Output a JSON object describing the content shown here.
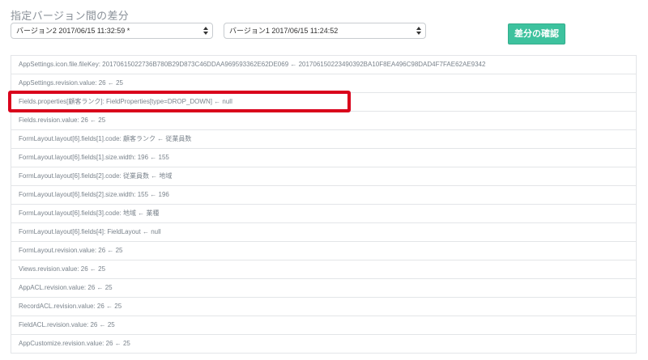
{
  "page": {
    "title": "指定バージョン間の差分"
  },
  "controls": {
    "version_a": "バージョン2 2017/06/15 11:32:59 *",
    "version_b": "バージョン1 2017/06/15 11:24:52",
    "compare_button": "差分の確認"
  },
  "diff_rows": [
    "AppSettings.icon.file.fileKey: 20170615022736B780B29D873C46DDAA969593362E62DE069 ← 20170615022349039​2BA10F8EA496C98DAD4F7FAE62AE9342",
    "AppSettings.revision.value: 26 ← 25",
    "Fields.properties[顧客ランク]: FieldProperties[type=DROP_DOWN] ← null",
    "Fields.revision.value: 26 ← 25",
    "FormLayout.layout[6].fields[1].code: 顧客ランク ← 従業員数",
    "FormLayout.layout[6].fields[1].size.width: 196 ← 155",
    "FormLayout.layout[6].fields[2].code: 従業員数 ← 地域",
    "FormLayout.layout[6].fields[2].size.width: 155 ← 196",
    "FormLayout.layout[6].fields[3].code: 地域 ← 業種",
    "FormLayout.layout[6].fields[4]: FieldLayout ← null",
    "FormLayout.revision.value: 26 ← 25",
    "Views.revision.value: 26 ← 25",
    "AppACL.revision.value: 26 ← 25",
    "RecordACL.revision.value: 26 ← 25",
    "FieldACL.revision.value: 26 ← 25",
    "AppCustomize.revision.value: 26 ← 25"
  ],
  "colors": {
    "accent": "#3dc29e",
    "highlight": "#d9001b"
  }
}
